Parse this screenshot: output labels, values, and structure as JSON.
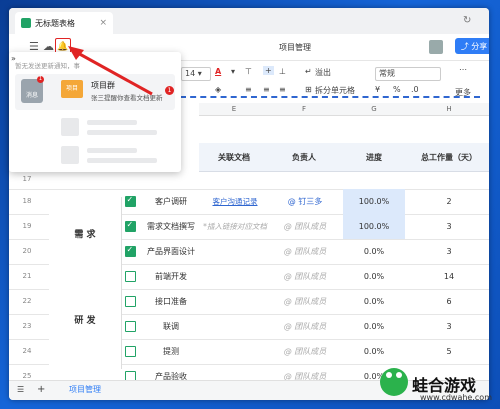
{
  "window": {
    "tab_title": "无标题表格"
  },
  "docbar": {
    "doc_title": "项目管理",
    "share_label": "分享"
  },
  "toolbar": {
    "font_size": "14",
    "overflow_label": "溢出",
    "format_label": "常规",
    "split_label": "拆分单元格",
    "more_label": "更多"
  },
  "columns": [
    "E",
    "F",
    "G",
    "H"
  ],
  "headers": {
    "doc": "关联文档",
    "owner": "负责人",
    "progress": "进度",
    "workload": "总工作量（天）"
  },
  "groups": {
    "req": "需 求",
    "dev": "研 发"
  },
  "rows": [
    {
      "n": "17",
      "task": "",
      "doc": "",
      "owner": "",
      "progress": "",
      "work": "",
      "checked": false
    },
    {
      "n": "18",
      "task": "客户调研",
      "doc": "客户沟通记录",
      "owner": "@ 钉三多",
      "progress": "100.0%",
      "work": "2",
      "checked": true
    },
    {
      "n": "19",
      "task": "需求文档撰写",
      "doc": "*插入链接对应文档",
      "owner": "@ 团队成员",
      "progress": "100.0%",
      "work": "3",
      "checked": true
    },
    {
      "n": "20",
      "task": "产品界面设计",
      "doc": "",
      "owner": "@ 团队成员",
      "progress": "0.0%",
      "work": "3",
      "checked": true
    },
    {
      "n": "21",
      "task": "前端开发",
      "doc": "",
      "owner": "@ 团队成员",
      "progress": "0.0%",
      "work": "14",
      "checked": false
    },
    {
      "n": "22",
      "task": "接口准备",
      "doc": "",
      "owner": "@ 团队成员",
      "progress": "0.0%",
      "work": "6",
      "checked": false
    },
    {
      "n": "23",
      "task": "联调",
      "doc": "",
      "owner": "@ 团队成员",
      "progress": "0.0%",
      "work": "3",
      "checked": false
    },
    {
      "n": "24",
      "task": "提测",
      "doc": "",
      "owner": "@ 团队成员",
      "progress": "0.0%",
      "work": "5",
      "checked": false
    },
    {
      "n": "25",
      "task": "产品验收",
      "doc": "",
      "owner": "@ 团队成员",
      "progress": "0.0%",
      "work": "",
      "checked": false
    }
  ],
  "statusbar": {
    "sheet_name": "项目管理"
  },
  "popup": {
    "hint": "暂无发送更新通知，事",
    "badge_label": "消息",
    "group_label": "项目",
    "title": "项目群",
    "subtitle": "张三提醒你查看文档更新",
    "count": "1",
    "dot": "1"
  },
  "watermark": {
    "name": "蛙合游戏",
    "url": "www.cdwahe.com"
  },
  "colors": {
    "accent": "#2f7df6",
    "green": "#21a366",
    "red": "#e02424"
  }
}
